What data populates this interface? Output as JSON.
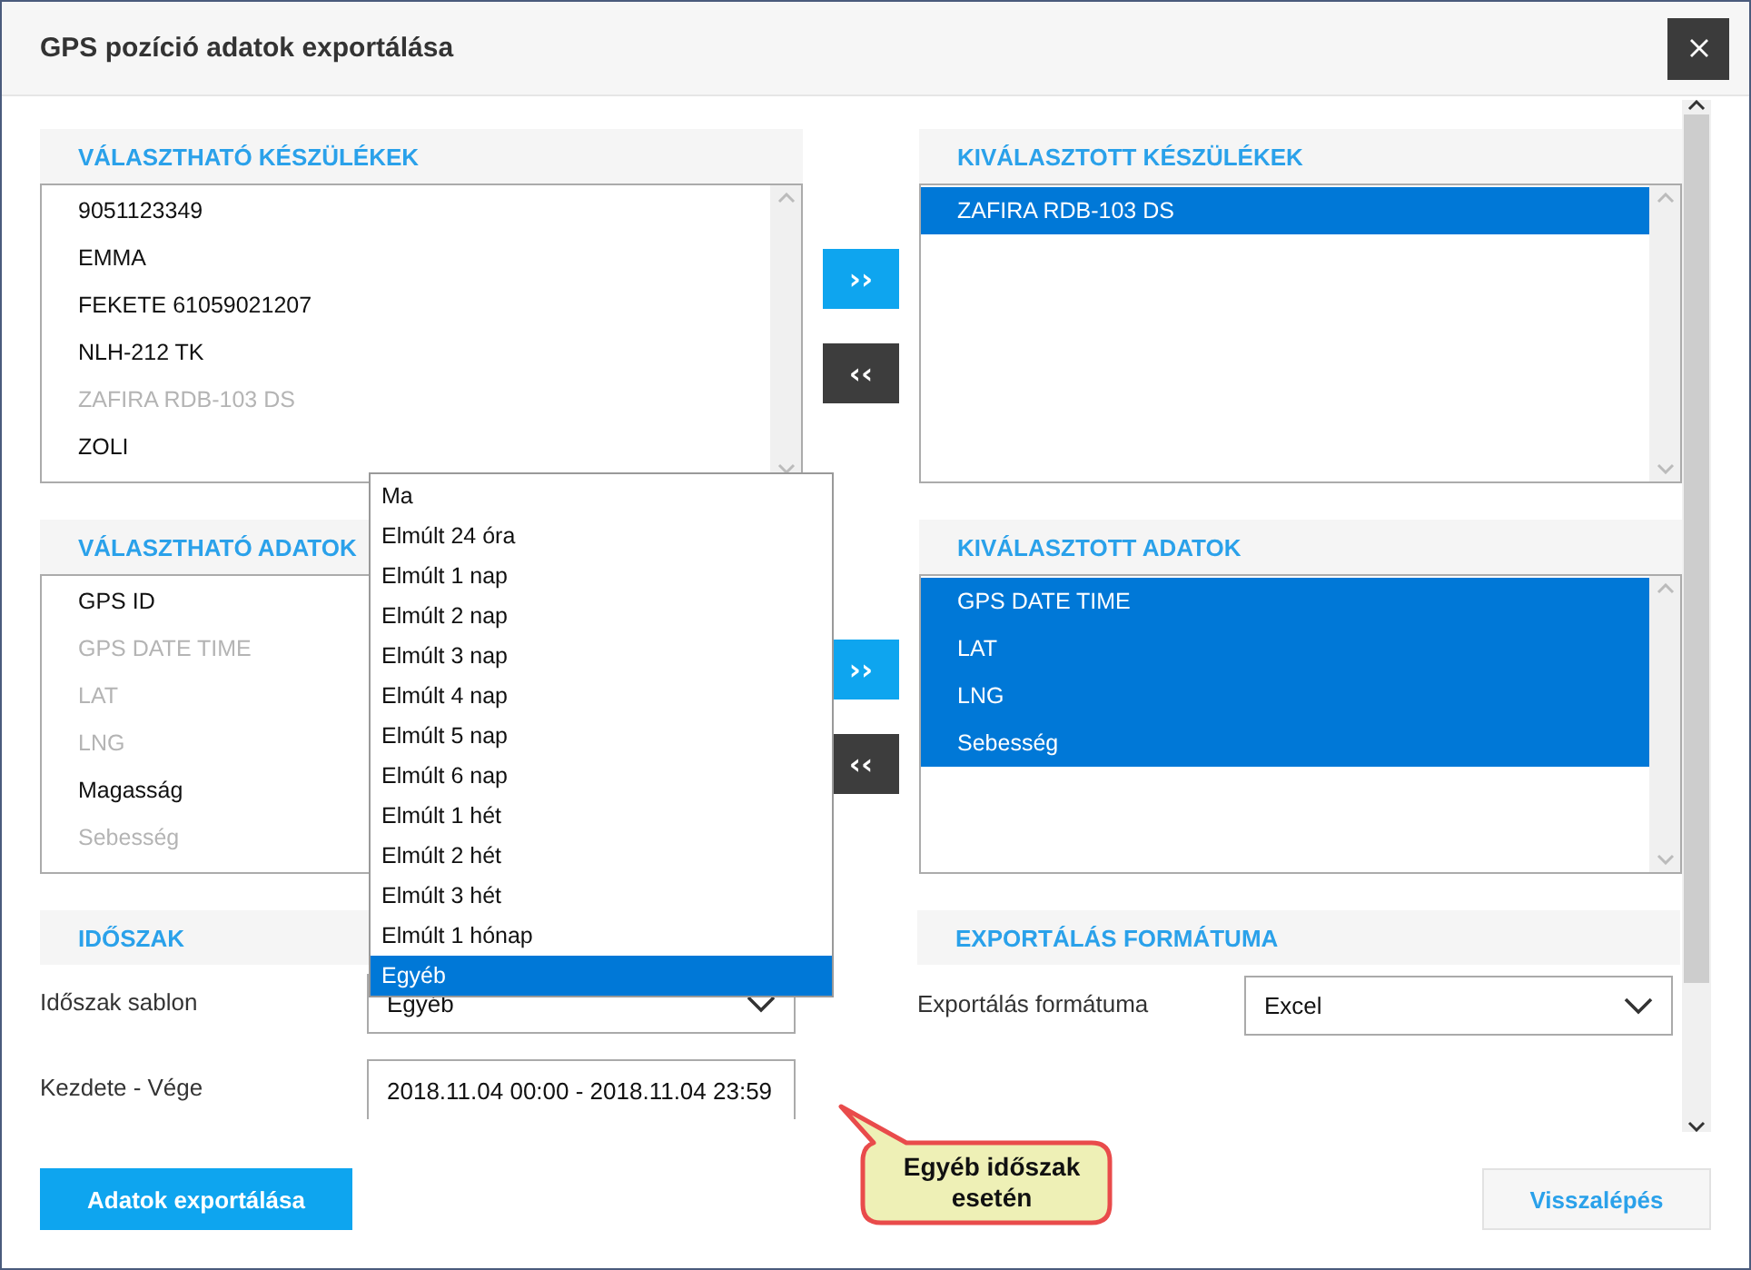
{
  "dialog": {
    "title": "GPS pozíció adatok exportálása"
  },
  "available_devices": {
    "title": "VÁLASZTHATÓ KÉSZÜLÉKEK",
    "items": [
      {
        "label": "9051123349",
        "disabled": false
      },
      {
        "label": "EMMA",
        "disabled": false
      },
      {
        "label": "FEKETE 61059021207",
        "disabled": false
      },
      {
        "label": "NLH-212 TK",
        "disabled": false
      },
      {
        "label": "ZAFIRA RDB-103 DS",
        "disabled": true
      },
      {
        "label": "ZOLI",
        "disabled": false
      }
    ]
  },
  "device_transfer": {
    "add": "››",
    "remove": "‹‹"
  },
  "selected_devices": {
    "title": "KIVÁLASZTOTT KÉSZÜLÉKEK",
    "items": [
      {
        "label": "ZAFIRA RDB-103 DS",
        "selected": true
      }
    ]
  },
  "available_data": {
    "title": "VÁLASZTHATÓ ADATOK",
    "items": [
      {
        "label": "GPS ID",
        "disabled": false
      },
      {
        "label": "GPS DATE TIME",
        "disabled": true
      },
      {
        "label": "LAT",
        "disabled": true
      },
      {
        "label": "LNG",
        "disabled": true
      },
      {
        "label": "Magasság",
        "disabled": false
      },
      {
        "label": "Sebesség",
        "disabled": true
      }
    ]
  },
  "data_transfer": {
    "add": "››",
    "remove": "‹‹"
  },
  "selected_data": {
    "title": "KIVÁLASZTOTT ADATOK",
    "items": [
      {
        "label": "GPS DATE TIME",
        "selected": true
      },
      {
        "label": "LAT",
        "selected": true
      },
      {
        "label": "LNG",
        "selected": true
      },
      {
        "label": "Sebesség",
        "selected": true
      }
    ]
  },
  "period": {
    "title": "IDŐSZAK",
    "template_label": "Időszak sablon",
    "template_value": "Egyéb",
    "range_label": "Kezdete - Vége",
    "range_value": "2018.11.04 00:00 - 2018.11.04 23:59"
  },
  "period_dropdown": {
    "options": [
      {
        "label": "Ma",
        "selected": false
      },
      {
        "label": "Elmúlt 24 óra",
        "selected": false
      },
      {
        "label": "Elmúlt 1 nap",
        "selected": false
      },
      {
        "label": "Elmúlt 2 nap",
        "selected": false
      },
      {
        "label": "Elmúlt 3 nap",
        "selected": false
      },
      {
        "label": "Elmúlt 4 nap",
        "selected": false
      },
      {
        "label": "Elmúlt 5 nap",
        "selected": false
      },
      {
        "label": "Elmúlt 6 nap",
        "selected": false
      },
      {
        "label": "Elmúlt 1 hét",
        "selected": false
      },
      {
        "label": "Elmúlt 2 hét",
        "selected": false
      },
      {
        "label": "Elmúlt 3 hét",
        "selected": false
      },
      {
        "label": "Elmúlt 1 hónap",
        "selected": false
      },
      {
        "label": "Egyéb",
        "selected": true
      }
    ]
  },
  "export_format": {
    "title": "EXPORTÁLÁS FORMÁTUMA",
    "label": "Exportálás formátuma",
    "value": "Excel"
  },
  "buttons": {
    "export": "Adatok exportálása",
    "back": "Visszalépés"
  },
  "callout": {
    "text": "Egyéb időszak esetén"
  }
}
